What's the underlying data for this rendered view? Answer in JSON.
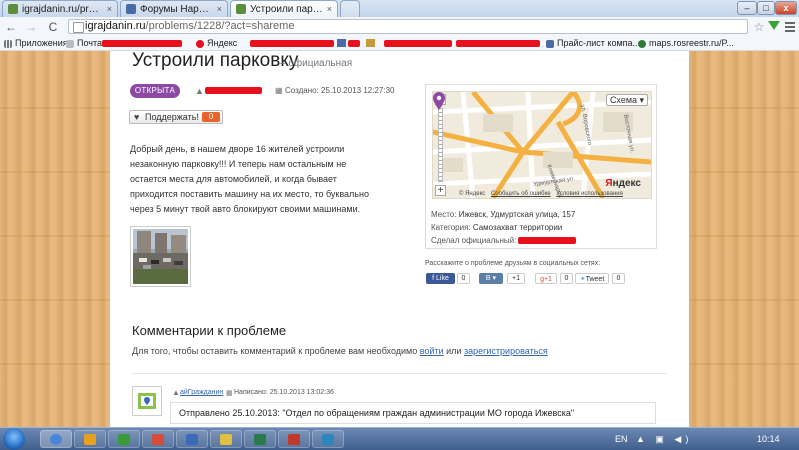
{
  "browser": {
    "tabs": [
      {
        "label": "igrajdanin.ru/problems/1",
        "fav_color": "#5b8f3a"
      },
      {
        "label": "Форумы Народного Инт",
        "fav_color": "#4a6aa8"
      },
      {
        "label": "Устроили парковку",
        "fav_color": "#5b8f3a"
      }
    ],
    "tab_close": "×",
    "window_buttons": {
      "minimize": "–",
      "maximize": "□",
      "close": "x"
    },
    "url_host": "igrajdanin.ru",
    "url_path": "/problems/1228/?act=shareme",
    "nav": {
      "back": "←",
      "forward": "→",
      "reload": "C",
      "star": "☆"
    },
    "bookmarks": [
      {
        "label": "Приложения",
        "color": "#777"
      },
      {
        "label": "Почта",
        "color": "#999"
      },
      {
        "label": "Яндекс",
        "color": "#e8101c"
      },
      {
        "label": "Прайс-лист компа...",
        "color": "#4a6aa8"
      },
      {
        "label": "maps.rosreestr.ru/P...",
        "color": "#2a7a3a"
      }
    ]
  },
  "problem": {
    "title": "Устроили парковку",
    "type": "– официальная",
    "status": "ОТКРЫТА",
    "created": "Создано: 25.10.2013 12:27:30",
    "support_label": "Поддержать!",
    "support_count": "0",
    "description": "Добрый день, в нашем дворе 16 жителей устроили незаконную парковку!!! И теперь нам остальным не остается места для автомобилей, и когда бывает приходится поставить машину на их место, то буквально через 5 минут твой авто блокируют своими машинами."
  },
  "map": {
    "scheme": "Схема ▾",
    "zoom_in": "+",
    "zoom_out": "−",
    "copyright": "© Яндекс",
    "report_error": "Сообщить об ошибке",
    "terms": "Условия использования",
    "logo_red": "Я",
    "logo_rest": "ндекс",
    "streets": [
      "ул. Воровского",
      "Восточная ул.",
      "Коммунаров ул.",
      "Удмуртская ул."
    ]
  },
  "info": {
    "place_label": "Место:",
    "place": "Ижевск, Удмуртская улица, 157",
    "category_label": "Категория:",
    "category": "Самозахват территории",
    "maker_label": "Сделал официальный:"
  },
  "share": {
    "title": "Расскажите о проблеме друзьям в социальных сетях:",
    "facebook": "f Like",
    "facebook_count": "0",
    "vk": "B ▾",
    "vk_count": "+1",
    "gplus": "g+1",
    "gplus_count": "0",
    "twitter": "Tweet",
    "twitter_count": "0",
    "colors": {
      "facebook": "#3b5998",
      "vk": "#5b7fa6",
      "gplus": "#dd4b39",
      "twitter": "#55acee"
    }
  },
  "comments": {
    "title": "Комментарии к проблеме",
    "hint_before": "Для того, чтобы оставить комментарий к проблеме вам необходимо",
    "login": "войти",
    "or": "или",
    "register": "зарегистрироваться",
    "author": "айГражданин",
    "date": "Написано: 25.10.2013 13:02:36",
    "text": "Отправлено 25.10.2013: \"Отдел по обращениям граждан администрации МО города Ижевска\""
  },
  "taskbar": {
    "lang": "EN",
    "tray": "▲ ▣ ◀)",
    "time": "10:14",
    "apps": [
      {
        "color": "#4a86d8"
      },
      {
        "color": "#e8a020"
      },
      {
        "color": "#3a9a3a"
      },
      {
        "color": "#d84a3a"
      },
      {
        "color": "#3a6ab8"
      },
      {
        "color": "#e0c040"
      },
      {
        "color": "#2a7a4a"
      },
      {
        "color": "#c0392b"
      },
      {
        "color": "#2e86c1"
      }
    ]
  }
}
